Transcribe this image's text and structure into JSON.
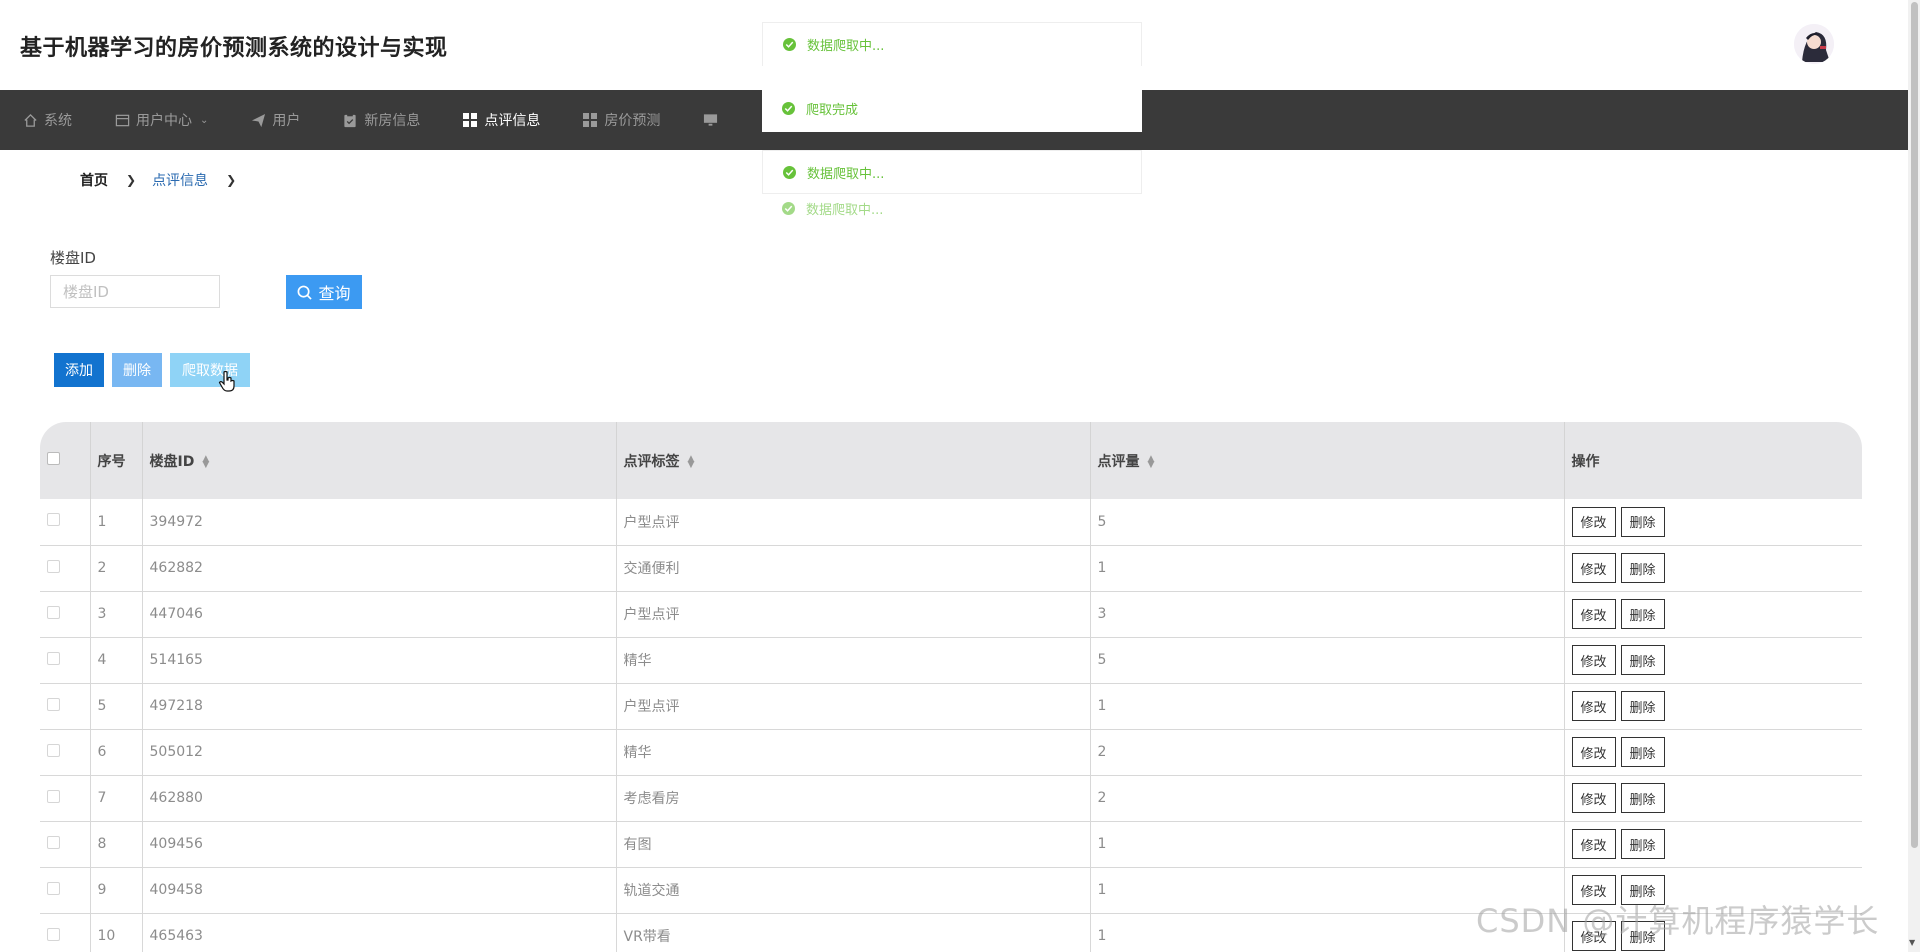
{
  "app": {
    "title": "基于机器学习的房价预测系统的设计与实现"
  },
  "nav": {
    "items": [
      {
        "label": "系统",
        "icon": "home-icon"
      },
      {
        "label": "用户中心",
        "icon": "window-icon",
        "has_dropdown": true
      },
      {
        "label": "用户",
        "icon": "send-icon"
      },
      {
        "label": "新房信息",
        "icon": "clipboard-icon"
      },
      {
        "label": "点评信息",
        "icon": "grid-icon",
        "active": true
      },
      {
        "label": "房价预测",
        "icon": "grid-icon"
      },
      {
        "label": "",
        "icon": "monitor-icon"
      }
    ]
  },
  "breadcrumb": {
    "home": "首页",
    "current": "点评信息"
  },
  "filter": {
    "label": "楼盘ID",
    "placeholder": "楼盘ID",
    "search_label": "查询"
  },
  "actions": {
    "add": "添加",
    "delete": "删除",
    "crawl": "爬取数据"
  },
  "table": {
    "headers": [
      "序号",
      "楼盘ID",
      "点评标签",
      "点评量",
      "操作"
    ],
    "rows": [
      {
        "no": "1",
        "building_id": "394972",
        "tag": "户型点评",
        "count": "5"
      },
      {
        "no": "2",
        "building_id": "462882",
        "tag": "交通便利",
        "count": "1"
      },
      {
        "no": "3",
        "building_id": "447046",
        "tag": "户型点评",
        "count": "3"
      },
      {
        "no": "4",
        "building_id": "514165",
        "tag": "精华",
        "count": "5"
      },
      {
        "no": "5",
        "building_id": "497218",
        "tag": "户型点评",
        "count": "1"
      },
      {
        "no": "6",
        "building_id": "505012",
        "tag": "精华",
        "count": "2"
      },
      {
        "no": "7",
        "building_id": "462880",
        "tag": "考虑看房",
        "count": "2"
      },
      {
        "no": "8",
        "building_id": "409456",
        "tag": "有图",
        "count": "1"
      },
      {
        "no": "9",
        "building_id": "409458",
        "tag": "轨道交通",
        "count": "1"
      },
      {
        "no": "10",
        "building_id": "465463",
        "tag": "VR带看",
        "count": "1"
      }
    ],
    "edit_label": "修改",
    "delete_label": "删除"
  },
  "toasts": [
    "数据爬取中...",
    "爬取完成",
    "数据爬取中...",
    "数据爬取中..."
  ],
  "watermark": "CSDN @计算机程序猿学长",
  "colors": {
    "nav_bg": "#3a3a3a",
    "primary": "#1273cf",
    "search": "#3c9af2",
    "success": "#67c23a"
  }
}
